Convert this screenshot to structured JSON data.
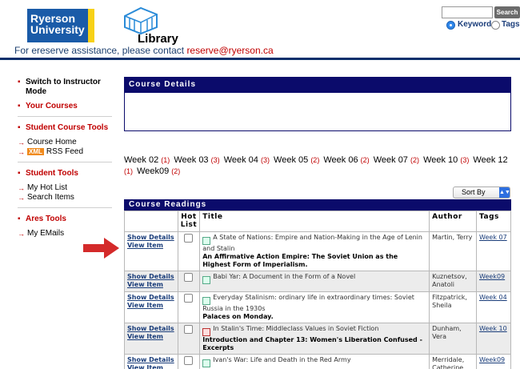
{
  "header": {
    "university_line1": "Ryerson",
    "university_line2": "University",
    "library_label": "Library",
    "contact_text": "For ereserve assistance, please contact ",
    "contact_email": "reserve@ryerson.ca",
    "search_button": "Search",
    "search_value": "",
    "radio_keyword": "Keyword",
    "radio_tags": "Tags"
  },
  "sidebar": {
    "switch_instructor": "Switch to Instructor Mode",
    "your_courses": "Your Courses",
    "student_course_tools": "Student Course Tools",
    "course_home": "Course Home",
    "xml_badge": "XML",
    "rss_feed": "RSS Feed",
    "student_tools": "Student Tools",
    "my_hot_list": "My Hot List",
    "search_items": "Search Items",
    "ares_tools": "Ares Tools",
    "my_emails": "My EMails"
  },
  "course_details": {
    "title": "Course Details"
  },
  "weeks": [
    {
      "label": "Week 02",
      "count": "(1)"
    },
    {
      "label": "Week 03",
      "count": "(3)"
    },
    {
      "label": "Week 04",
      "count": "(3)"
    },
    {
      "label": "Week 05",
      "count": "(2)"
    },
    {
      "label": "Week 06",
      "count": "(2)"
    },
    {
      "label": "Week 07",
      "count": "(2)"
    },
    {
      "label": "Week 10",
      "count": "(3)"
    },
    {
      "label": "Week 12",
      "count": "(1)"
    },
    {
      "label": "Week09",
      "count": "(2)"
    }
  ],
  "sort_by": "Sort By",
  "readings": {
    "title": "Course Readings",
    "columns": [
      "",
      "Hot List",
      "Title",
      "Author",
      "Tags"
    ],
    "show_details": "Show Details",
    "view_item": "View Item",
    "rows": [
      {
        "title": "A State of Nations: Empire and Nation-Making in the Age of Lenin and Stalin",
        "subtitle": "An Affirmative Action Empire: The Soviet Union as the Highest Form of Imperialism.",
        "author": "Martin, Terry",
        "tag": "Week 07"
      },
      {
        "title": "Babi Yar: A Document in the Form of a Novel",
        "subtitle": "",
        "author": "Kuznetsov, Anatoli",
        "tag": "Week09"
      },
      {
        "title": "Everyday Stalinism: ordinary life in extraordinary times: Soviet Russia in the 1930s",
        "subtitle": "Palaces on Monday.",
        "author": "Fitzpatrick, Sheila",
        "tag": "Week 04"
      },
      {
        "title": "In Stalin's Time: Middleclass Values in Soviet Fiction",
        "subtitle": "Introduction and Chapter 13: Women's Liberation Confused - Excerpts",
        "author": "Dunham, Vera",
        "tag": "Week 10"
      },
      {
        "title": "Ivan's War: Life and Death in the Red Army",
        "subtitle": "",
        "author": "Merridale, Catherine",
        "tag": "Week09"
      }
    ]
  },
  "colors": {
    "navy": "#0b0b6b",
    "red_accent": "#c00000",
    "arrow_red": "#d42a2a"
  }
}
